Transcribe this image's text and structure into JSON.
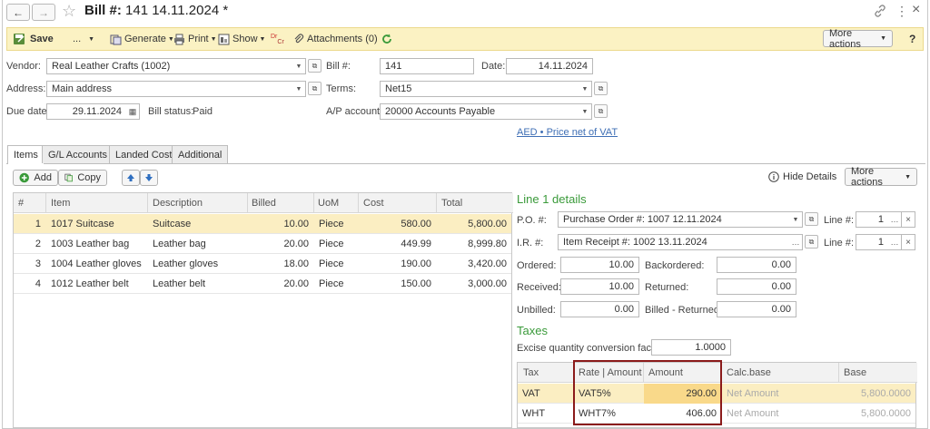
{
  "header": {
    "title_prefix": "Bill #:",
    "title_rest": " 141 14.11.2024 *",
    "back_icon": "←",
    "forward_icon": "→",
    "star_icon": "☆",
    "link_icon": "🔗",
    "more_icon": "⋮",
    "close_icon": "×"
  },
  "toolbar": {
    "save": "Save",
    "ellipsis": "...",
    "generate": "Generate",
    "print": "Print",
    "show": "Show",
    "attachments": "Attachments (0)",
    "more_actions": "More actions",
    "help": "?"
  },
  "form": {
    "vendor_label": "Vendor:",
    "vendor": "Real Leather Crafts (1002)",
    "address_label": "Address:",
    "address": "Main address",
    "due_label": "Due date:",
    "due_date": "29.11.2024",
    "bill_status_label": "Bill status:",
    "bill_status": "Paid",
    "bill_no_label": "Bill #:",
    "bill_no": "141",
    "date_label": "Date:",
    "date": "14.11.2024",
    "terms_label": "Terms:",
    "terms": "Net15",
    "ap_label": "A/P account:",
    "ap_account": "20000 Accounts Payable",
    "price_link": "AED • Price net of VAT"
  },
  "tabs": [
    "Items",
    "G/L Accounts",
    "Landed Cost",
    "Additional"
  ],
  "items_toolbar": {
    "add": "Add",
    "copy": "Copy",
    "hide_details": "Hide Details",
    "more_actions": "More actions"
  },
  "items_table": {
    "columns": [
      "#",
      "Item",
      "Description",
      "Billed",
      "UoM",
      "Cost",
      "Total"
    ],
    "rows": [
      {
        "n": "1",
        "item": "1017 Suitcase",
        "desc": "Suitcase",
        "billed": "10.00",
        "uom": "Piece",
        "cost": "580.00",
        "total": "5,800.00"
      },
      {
        "n": "2",
        "item": "1003 Leather bag",
        "desc": "Leather bag",
        "billed": "20.00",
        "uom": "Piece",
        "cost": "449.99",
        "total": "8,999.80"
      },
      {
        "n": "3",
        "item": "1004 Leather gloves",
        "desc": "Leather gloves",
        "billed": "18.00",
        "uom": "Piece",
        "cost": "190.00",
        "total": "3,420.00"
      },
      {
        "n": "4",
        "item": "1012 Leather belt",
        "desc": "Leather belt",
        "billed": "20.00",
        "uom": "Piece",
        "cost": "150.00",
        "total": "3,000.00"
      }
    ]
  },
  "details": {
    "title": "Line 1 details",
    "po_label": "P.O. #:",
    "po": "Purchase Order #: 1007 12.11.2024",
    "ir_label": "I.R. #:",
    "ir": "Item Receipt #: 1002 13.11.2024",
    "line_label": "Line #:",
    "po_line": "1",
    "ir_line": "1",
    "ordered_label": "Ordered:",
    "ordered": "10.00",
    "backordered_label": "Backordered:",
    "backordered": "0.00",
    "received_label": "Received:",
    "received": "10.00",
    "returned_label": "Returned:",
    "returned": "0.00",
    "unbilled_label": "Unbilled:",
    "unbilled": "0.00",
    "billed_returned_label": "Billed - Returned:",
    "billed_returned": "0.00",
    "taxes_title": "Taxes",
    "excise_label": "Excise quantity conversion factor:",
    "excise": "1.0000"
  },
  "tax_table": {
    "columns": [
      "Tax",
      "Rate | Amount",
      "Amount",
      "Calc.base",
      "Base"
    ],
    "rows": [
      {
        "tax": "VAT",
        "rate": "VAT5%",
        "amount": "290.00",
        "calc": "Net Amount",
        "base": "5,800.0000"
      },
      {
        "tax": "WHT",
        "rate": "WHT7%",
        "amount": "406.00",
        "calc": "Net Amount",
        "base": "5,800.0000"
      }
    ]
  },
  "colors": {
    "toolbar_bg": "#fbf2c3",
    "selected_row": "#fbeec2",
    "accent_green": "#3a9a3a",
    "link_blue": "#3f6fb5",
    "highlight_red": "#8b1a1a"
  }
}
